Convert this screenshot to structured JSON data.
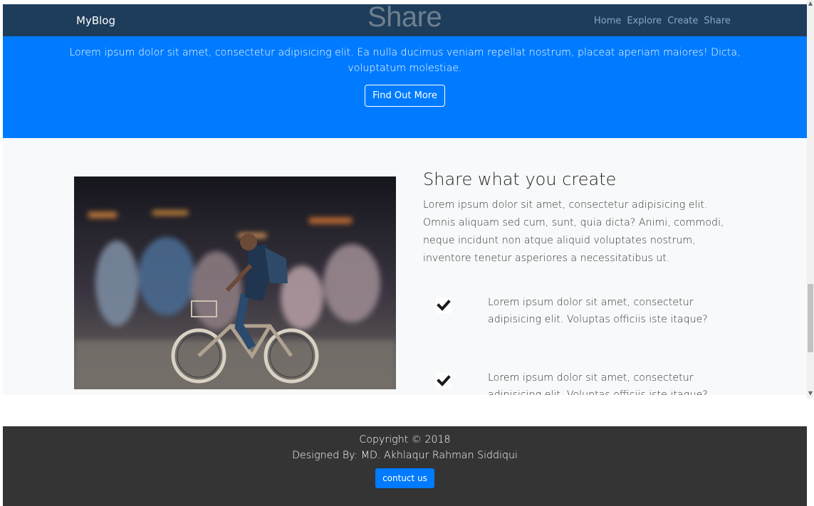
{
  "navbar": {
    "brand": "MyBlog",
    "title": "Share",
    "links": [
      "Home",
      "Explore",
      "Create",
      "Share"
    ]
  },
  "hero": {
    "text": "Lorem ipsum dolor sit amet, consectetur adipisicing elit. Ea nulla ducimus veniam repellat nostrum, placeat aperiam maiores! Dicta, voluptatum molestiae.",
    "button_label": "Find Out More"
  },
  "feature": {
    "title": "Share what you create",
    "text": "Lorem ipsum dolor sit amet, consectetur adipisicing elit. Omnis aliquam sed cum, sunt, quia dicta? Animi, commodi, neque incidunt non atque aliquid voluptates nostrum, inventore tenetur asperiores a necessitatibus ut.",
    "items": [
      {
        "icon": "check-icon",
        "text": "Lorem ipsum dolor sit amet, consectetur adipisicing elit. Voluptas officiis iste itaque?"
      },
      {
        "icon": "check-icon",
        "text": "Lorem ipsum dolor sit amet, consectetur adipisicing elit. Voluptas officiis iste itaque?"
      }
    ],
    "photo_icon": "cyclist-photo"
  },
  "footer": {
    "copyright": "Copyright © 2018",
    "designed_by": "Designed By: MD. Akhlaqur Rahman Siddiqui",
    "button_label": "contuct us"
  },
  "colors": {
    "navbar": "#1e3d5b",
    "hero": "#007bff",
    "footer": "#343434",
    "accent_button": "#007bff"
  }
}
